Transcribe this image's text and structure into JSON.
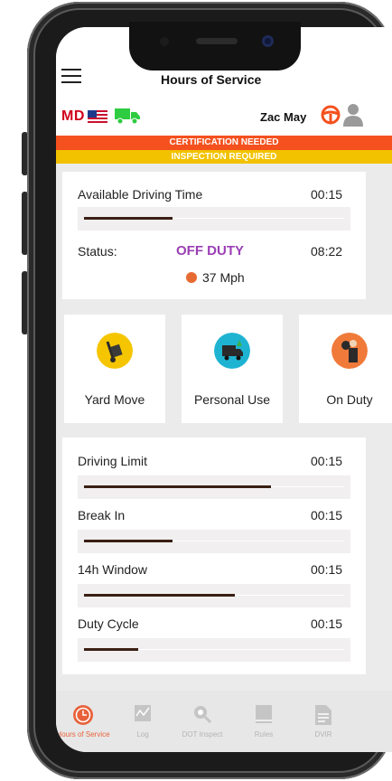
{
  "header": {
    "title": "Hours of Service"
  },
  "subheader": {
    "state": "MD",
    "driver_name": "Zac May"
  },
  "alerts": {
    "certification": "CERTIFICATION NEEDED",
    "inspection": "INSPECTION REQUIRED"
  },
  "summary": {
    "available_label": "Available Driving Time",
    "available_value": "00:15",
    "available_progress": 0.34,
    "status_label": "Status:",
    "status_value": "OFF DUTY",
    "status_time": "08:22",
    "speed": "37 Mph"
  },
  "duty_tiles": [
    {
      "label": "Yard Move"
    },
    {
      "label": "Personal Use"
    },
    {
      "label": "On Duty"
    }
  ],
  "limits": [
    {
      "label": "Driving Limit",
      "value": "00:15",
      "progress": 0.72
    },
    {
      "label": "Break In",
      "value": "00:15",
      "progress": 0.34
    },
    {
      "label": "14h Window",
      "value": "00:15",
      "progress": 0.58
    },
    {
      "label": "Duty Cycle",
      "value": "00:15",
      "progress": 0.21
    }
  ],
  "tabs": [
    {
      "label": "Hours of Service",
      "active": true
    },
    {
      "label": "Log"
    },
    {
      "label": "DOT Inspect"
    },
    {
      "label": "Rules"
    },
    {
      "label": "DVIR"
    }
  ],
  "colors": {
    "accent": "#e8613a",
    "status_purple": "#9b3fb5",
    "state_red": "#d0011b",
    "truck_green": "#2ecc40",
    "banner_red": "#f4511e",
    "banner_yellow": "#f2c200",
    "progress_fill": "#3a1f14"
  },
  "icons": [
    "menu-icon",
    "us-flag-icon",
    "truck-icon",
    "steering-wheel-icon",
    "person-icon",
    "speedometer-icon",
    "dolly-icon",
    "personal-truck-icon",
    "worker-clock-icon",
    "clock-icon",
    "chart-icon",
    "search-icon",
    "book-icon",
    "document-icon"
  ]
}
